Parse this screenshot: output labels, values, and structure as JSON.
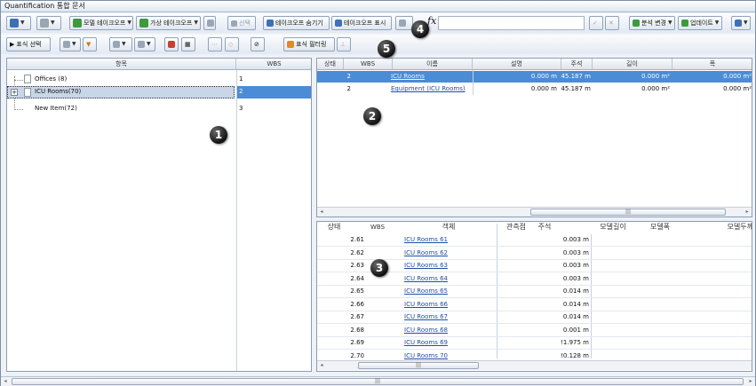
{
  "window": {
    "title": "Quantification 통합 문서"
  },
  "toolbar1": {
    "model_takeoff": "모델 테이크오프",
    "virtual_takeoff": "가상 테이크오프",
    "select": "선택",
    "hide_takeoff": "테이크오프 숨기기",
    "show_takeoff": "테이크오프 표시",
    "change_analysis": "분석 변경",
    "update": "업데이트"
  },
  "toolbar2": {
    "select_markup": "표식 선택",
    "markup_filter": "표식 필터링"
  },
  "tree": {
    "headers": {
      "item": "항목",
      "wbs": "WBS"
    },
    "rows": [
      {
        "name": "Offices (8)",
        "wbs": "1"
      },
      {
        "name": "ICU Rooms(70)",
        "wbs": "2"
      },
      {
        "name": "New Item(72)",
        "wbs": "3"
      }
    ]
  },
  "items_grid": {
    "headers": {
      "status": "상태",
      "wbs": "WBS",
      "name": "이름",
      "description": "설명",
      "annotation": "주석",
      "length": "길이",
      "width": "폭"
    },
    "rows": [
      {
        "wbs": "2",
        "name": "ICU Rooms",
        "description": "0.000 m",
        "annotation": "45.187 m",
        "length": "0.000 m²",
        "width": "0.000 m²"
      },
      {
        "wbs": "2",
        "name": "Equipment (ICU Rooms)",
        "description": "0.000 m",
        "annotation": "45.187 m",
        "length": "0.000 m²",
        "width": "0.000 m²"
      }
    ]
  },
  "objects_grid": {
    "headers": {
      "status": "상태",
      "wbs": "WBS",
      "object": "객체",
      "observation": "관측점",
      "annotation": "주석",
      "model_length": "모델길이",
      "model_width": "모델폭",
      "model_thickness": "모델두께"
    },
    "rows": [
      {
        "wbs": "2.61",
        "object": "ICU Rooms 61",
        "annotation": "0.003 m"
      },
      {
        "wbs": "2.62",
        "object": "ICU Rooms 62",
        "annotation": "0.003 m"
      },
      {
        "wbs": "2.63",
        "object": "ICU Rooms 63",
        "annotation": "0.003 m"
      },
      {
        "wbs": "2.64",
        "object": "ICU Rooms 64",
        "annotation": "0.003 m"
      },
      {
        "wbs": "2.65",
        "object": "ICU Rooms 65",
        "annotation": "0.014 m"
      },
      {
        "wbs": "2.66",
        "object": "ICU Rooms 66",
        "annotation": "0.014 m"
      },
      {
        "wbs": "2.67",
        "object": "ICU Rooms 67",
        "annotation": "0.014 m"
      },
      {
        "wbs": "2.68",
        "object": "ICU Rooms 68",
        "annotation": "0.001 m"
      },
      {
        "wbs": "2.69",
        "object": "ICU Rooms 69",
        "annotation": "!1.975 m"
      },
      {
        "wbs": "2.70",
        "object": "ICU Rooms 70",
        "annotation": "!0.128 m"
      }
    ]
  },
  "callouts": [
    "1",
    "2",
    "3",
    "4",
    "5"
  ],
  "colors": {
    "selection": "#4a8cd6",
    "link": "#1f4fa8",
    "callout": "#1a1a1a"
  }
}
